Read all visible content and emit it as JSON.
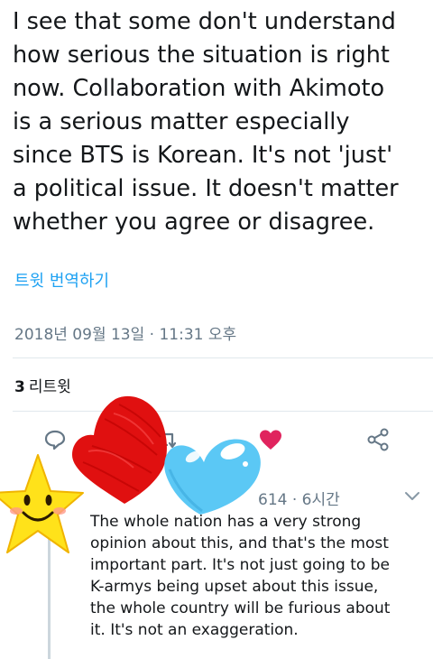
{
  "tweet": {
    "text": "I see that some don't understand\nhow serious the situation is right\nnow.  Collaboration with Akimoto\nis a serious matter especially\nsince BTS is Korean.  It's not 'just'\na political issue.  It doesn't matter\nwhether you agree or disagree.",
    "translate_label": "트윗 번역하기",
    "timestamp": "2018년 09월 13일 · 11:31 오후",
    "retweets": {
      "count": "3",
      "label": "리트윗"
    }
  },
  "actions": [
    {
      "name": "reply-icon"
    },
    {
      "name": "retweet-icon"
    },
    {
      "name": "like-icon",
      "liked": true
    },
    {
      "name": "share-icon"
    }
  ],
  "reply": {
    "meta": "614 · 6시간",
    "text": "The whole nation has a very strong\nopinion about this, and that's the most\nimportant part. It's not just going to be\nK-armys being upset about this issue,\nthe whole country will be furious about\nit. It's not an exaggeration."
  },
  "colors": {
    "link": "#1da1f2",
    "muted": "#657786",
    "like": "#e0245e",
    "red_heart_sticker": "#e01010",
    "blue_heart_sticker": "#5bc8f5",
    "star_sticker": "#ffe21a"
  }
}
